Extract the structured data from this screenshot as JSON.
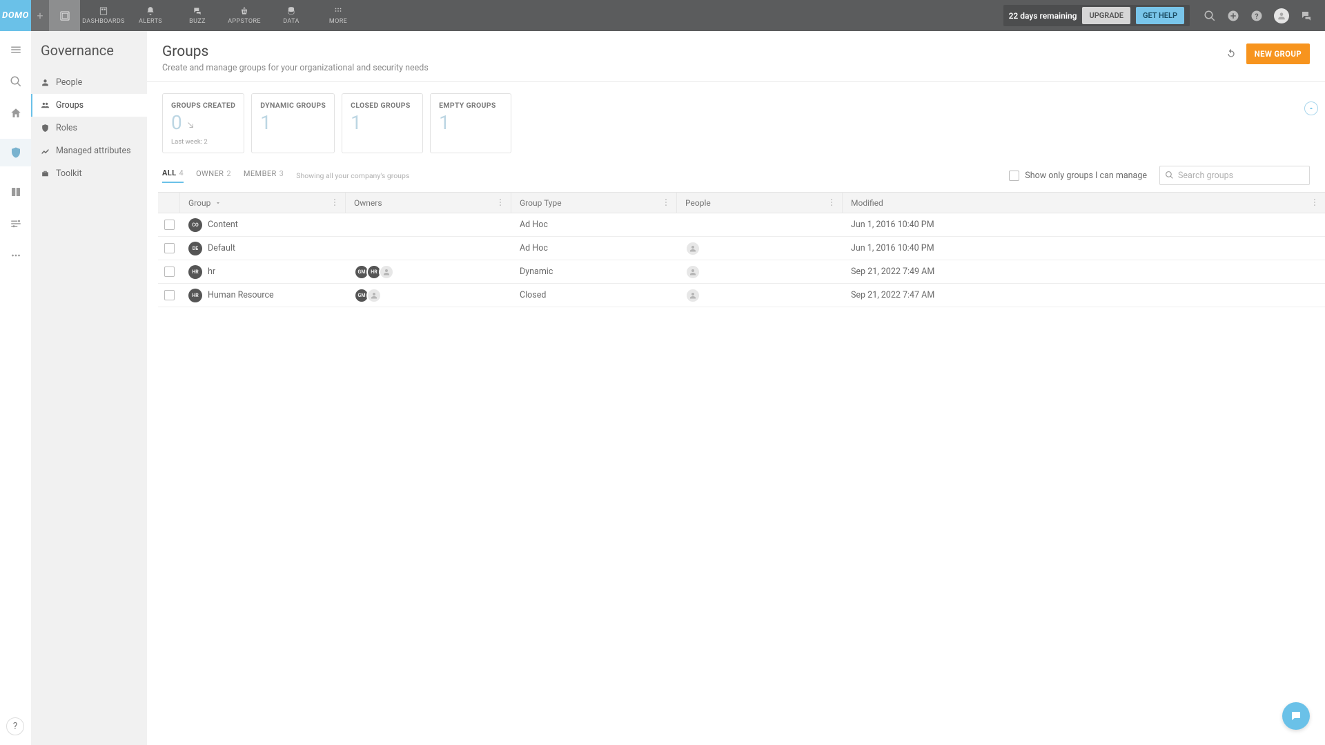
{
  "brand": "DOMO",
  "topnav": {
    "items": [
      {
        "label": "DASHBOARDS"
      },
      {
        "label": "ALERTS"
      },
      {
        "label": "BUZZ"
      },
      {
        "label": "APPSTORE"
      },
      {
        "label": "DATA"
      },
      {
        "label": "MORE"
      }
    ]
  },
  "trial": {
    "remaining": "22 days remaining",
    "upgrade": "UPGRADE",
    "gethelp": "GET HELP"
  },
  "sidebar": {
    "title": "Governance",
    "items": [
      {
        "label": "People"
      },
      {
        "label": "Groups"
      },
      {
        "label": "Roles"
      },
      {
        "label": "Managed attributes"
      },
      {
        "label": "Toolkit"
      }
    ]
  },
  "page": {
    "title": "Groups",
    "subtitle": "Create and manage groups for your organizational and security needs",
    "new_group": "NEW GROUP"
  },
  "stats": {
    "created": {
      "label": "GROUPS CREATED",
      "value": "0",
      "sub": "Last week: 2"
    },
    "dynamic": {
      "label": "DYNAMIC GROUPS",
      "value": "1"
    },
    "closed": {
      "label": "CLOSED GROUPS",
      "value": "1"
    },
    "empty": {
      "label": "EMPTY GROUPS",
      "value": "1"
    }
  },
  "filters": {
    "tabs": [
      {
        "label": "ALL",
        "count": "4"
      },
      {
        "label": "OWNER",
        "count": "2"
      },
      {
        "label": "MEMBER",
        "count": "3"
      }
    ],
    "hint": "Showing all your company's groups",
    "show_manage": "Show only groups I can manage",
    "search_placeholder": "Search groups"
  },
  "table": {
    "headers": {
      "group": "Group",
      "owners": "Owners",
      "type": "Group Type",
      "people": "People",
      "modified": "Modified"
    },
    "rows": [
      {
        "badge": "CO",
        "name": "Content",
        "owners": [],
        "type": "Ad Hoc",
        "people": [],
        "modified": "Jun 1, 2016 10:40 PM"
      },
      {
        "badge": "DE",
        "name": "Default",
        "owners": [],
        "type": "Ad Hoc",
        "people": [
          "blank"
        ],
        "modified": "Jun 1, 2016 10:40 PM"
      },
      {
        "badge": "HR",
        "name": "hr",
        "owners": [
          "GM",
          "HR",
          "blank"
        ],
        "type": "Dynamic",
        "people": [
          "blank"
        ],
        "modified": "Sep 21, 2022 7:49 AM"
      },
      {
        "badge": "HR",
        "name": "Human Resource",
        "owners": [
          "GM",
          "blank"
        ],
        "type": "Closed",
        "people": [
          "blank"
        ],
        "modified": "Sep 21, 2022 7:47 AM"
      }
    ]
  }
}
